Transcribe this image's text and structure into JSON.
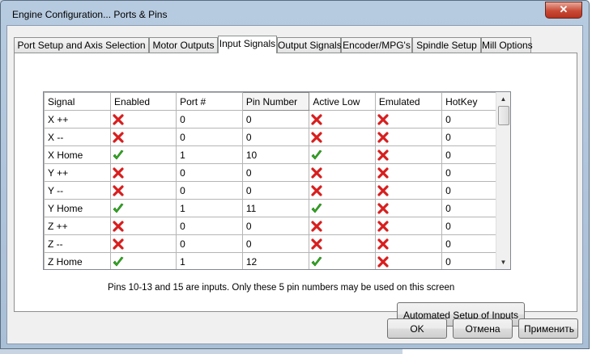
{
  "window": {
    "title": "Engine Configuration... Ports & Pins",
    "close_label": "✕"
  },
  "tabs": [
    {
      "label": "Port Setup and Axis Selection",
      "active": false
    },
    {
      "label": "Motor Outputs",
      "active": false
    },
    {
      "label": "Input Signals",
      "active": true
    },
    {
      "label": "Output Signals",
      "active": false
    },
    {
      "label": "Encoder/MPG's",
      "active": false
    },
    {
      "label": "Spindle Setup",
      "active": false
    },
    {
      "label": "Mill Options",
      "active": false
    }
  ],
  "grid": {
    "columns": [
      "Signal",
      "Enabled",
      "Port #",
      "Pin Number",
      "Active Low",
      "Emulated",
      "HotKey"
    ],
    "rows": [
      {
        "signal": "X ++",
        "enabled": false,
        "port": "0",
        "pin": "0",
        "active_low": false,
        "emulated": false,
        "hotkey": "0"
      },
      {
        "signal": "X --",
        "enabled": false,
        "port": "0",
        "pin": "0",
        "active_low": false,
        "emulated": false,
        "hotkey": "0"
      },
      {
        "signal": "X Home",
        "enabled": true,
        "port": "1",
        "pin": "10",
        "active_low": true,
        "emulated": false,
        "hotkey": "0"
      },
      {
        "signal": "Y ++",
        "enabled": false,
        "port": "0",
        "pin": "0",
        "active_low": false,
        "emulated": false,
        "hotkey": "0"
      },
      {
        "signal": "Y --",
        "enabled": false,
        "port": "0",
        "pin": "0",
        "active_low": false,
        "emulated": false,
        "hotkey": "0"
      },
      {
        "signal": "Y Home",
        "enabled": true,
        "port": "1",
        "pin": "11",
        "active_low": true,
        "emulated": false,
        "hotkey": "0"
      },
      {
        "signal": "Z ++",
        "enabled": false,
        "port": "0",
        "pin": "0",
        "active_low": false,
        "emulated": false,
        "hotkey": "0"
      },
      {
        "signal": "Z --",
        "enabled": false,
        "port": "0",
        "pin": "0",
        "active_low": false,
        "emulated": false,
        "hotkey": "0"
      },
      {
        "signal": "Z Home",
        "enabled": true,
        "port": "1",
        "pin": "12",
        "active_low": true,
        "emulated": false,
        "hotkey": "0"
      }
    ]
  },
  "info_text": "Pins 10-13 and 15 are inputs. Only these 5 pin numbers may be used on this screen",
  "buttons": {
    "auto_setup": "Automated Setup of Inputs",
    "ok": "OK",
    "cancel": "Отмена",
    "apply": "Применить"
  },
  "colors": {
    "check": "#2fae1e",
    "cross": "#d81e1e",
    "accent": "#b5321f"
  }
}
